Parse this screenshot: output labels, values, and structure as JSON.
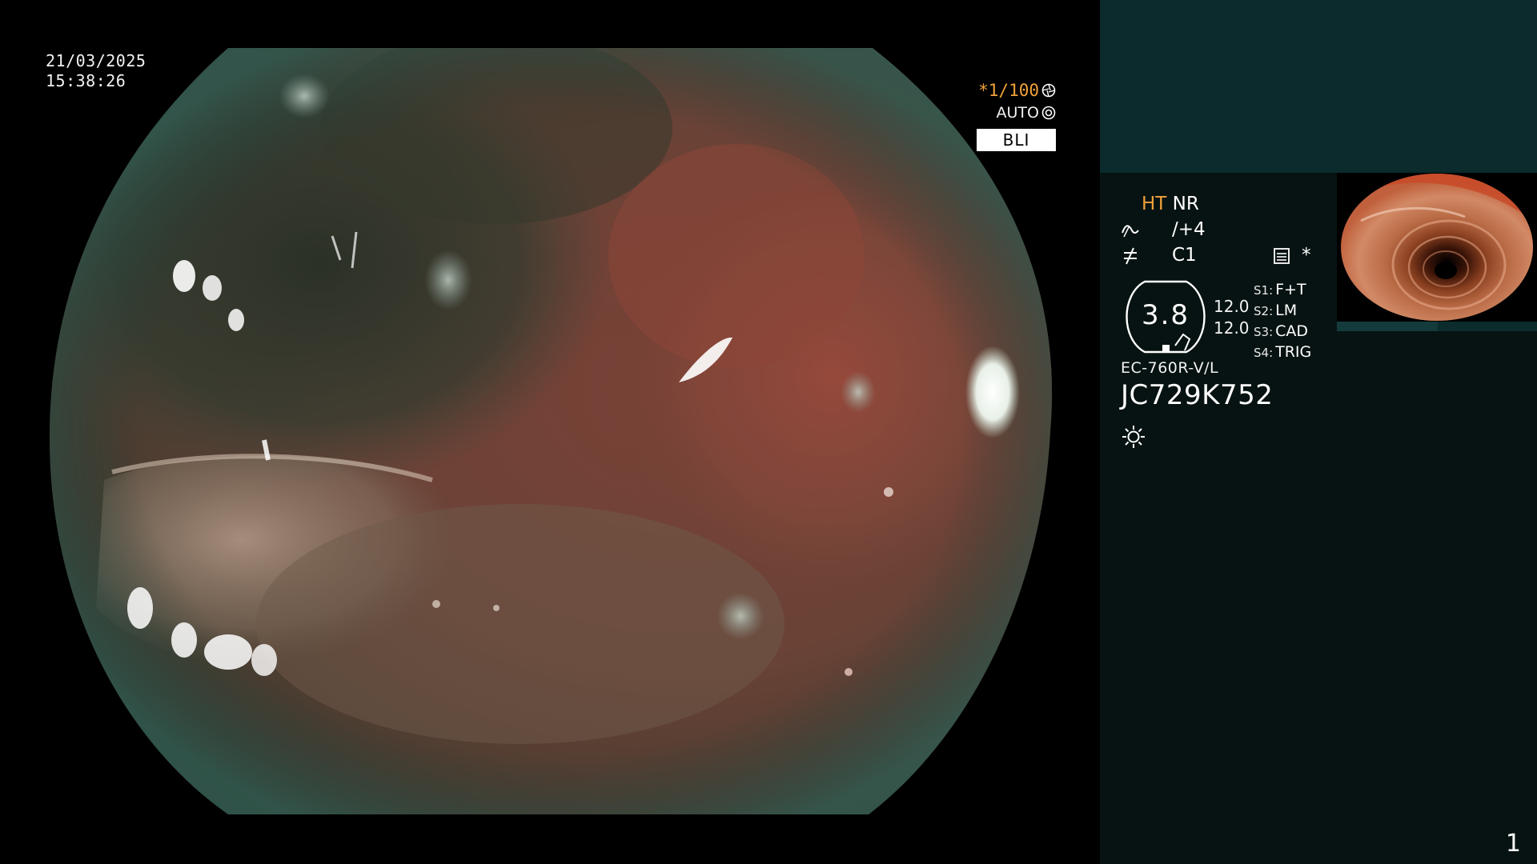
{
  "overlay": {
    "date": "21/03/2025",
    "time": "15:38:26",
    "shutter": "*1/100",
    "shutter_icon": "shutter-icon",
    "iris": "AUTO",
    "iris_icon": "iris-icon",
    "mode": "BLI"
  },
  "panel": {
    "ht_label": "HT",
    "nr_label": "NR",
    "enhance_value": "/+4",
    "enhance_icon": "enhancement-icon",
    "color_value": "C1",
    "color_icon": "color-tone-icon",
    "memory_icon": "memory-card-icon",
    "memory_mark": "*",
    "gauge_value": "3.8",
    "gauge_upper": "12.0",
    "gauge_lower": "12.0",
    "switches": [
      {
        "key": "S1:",
        "value": "F+T"
      },
      {
        "key": "S2:",
        "value": "LM"
      },
      {
        "key": "S3:",
        "value": "CAD"
      },
      {
        "key": "S4:",
        "value": "TRIG"
      }
    ],
    "scope_model": "EC-760R-V/L",
    "scope_serial": "JC729K752",
    "light_icon": "light-source-icon",
    "page_number": "1"
  },
  "colors": {
    "accent_orange": "#f0a23a",
    "panel_bg": "#071312",
    "panel_header": "#0b2b2c"
  }
}
